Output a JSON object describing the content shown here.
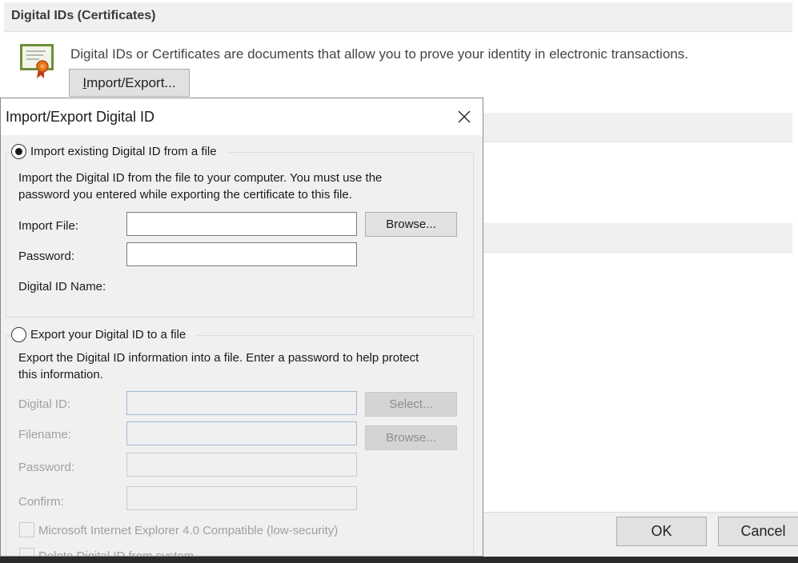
{
  "background": {
    "section_title": "Digital IDs (Certificates)",
    "description": "Digital IDs or Certificates are documents that allow you to prove your identity in electronic transactions.",
    "import_export_button": {
      "mnemonic": "I",
      "rest": "mport/Export..."
    },
    "ok_label": "OK",
    "cancel_label": "Cancel"
  },
  "dialog": {
    "title": "Import/Export Digital ID",
    "import_section": {
      "radio_label": "Import existing Digital ID from a file",
      "selected": true,
      "description_line1": "Import the Digital ID from the file to your computer. You must use the",
      "description_line2": "password you entered while exporting the certificate to this file.",
      "import_file_label": "Import File:",
      "import_file_value": "",
      "browse_label": "Browse...",
      "password_label": "Password:",
      "password_value": "",
      "digital_id_name_label": "Digital ID Name:"
    },
    "export_section": {
      "radio_label": "Export your Digital ID to a file",
      "selected": false,
      "description_line1": "Export the Digital ID information into a file. Enter a password to help protect",
      "description_line2": "this information.",
      "digital_id_label": "Digital ID:",
      "select_label": "Select...",
      "filename_label": "Filename:",
      "browse_label": "Browse...",
      "password_label": "Password:",
      "confirm_label": "Confirm:",
      "ie4_compatible_label": "Microsoft Internet Explorer 4.0 Compatible (low-security)",
      "delete_label": "Delete Digital ID from system"
    }
  }
}
